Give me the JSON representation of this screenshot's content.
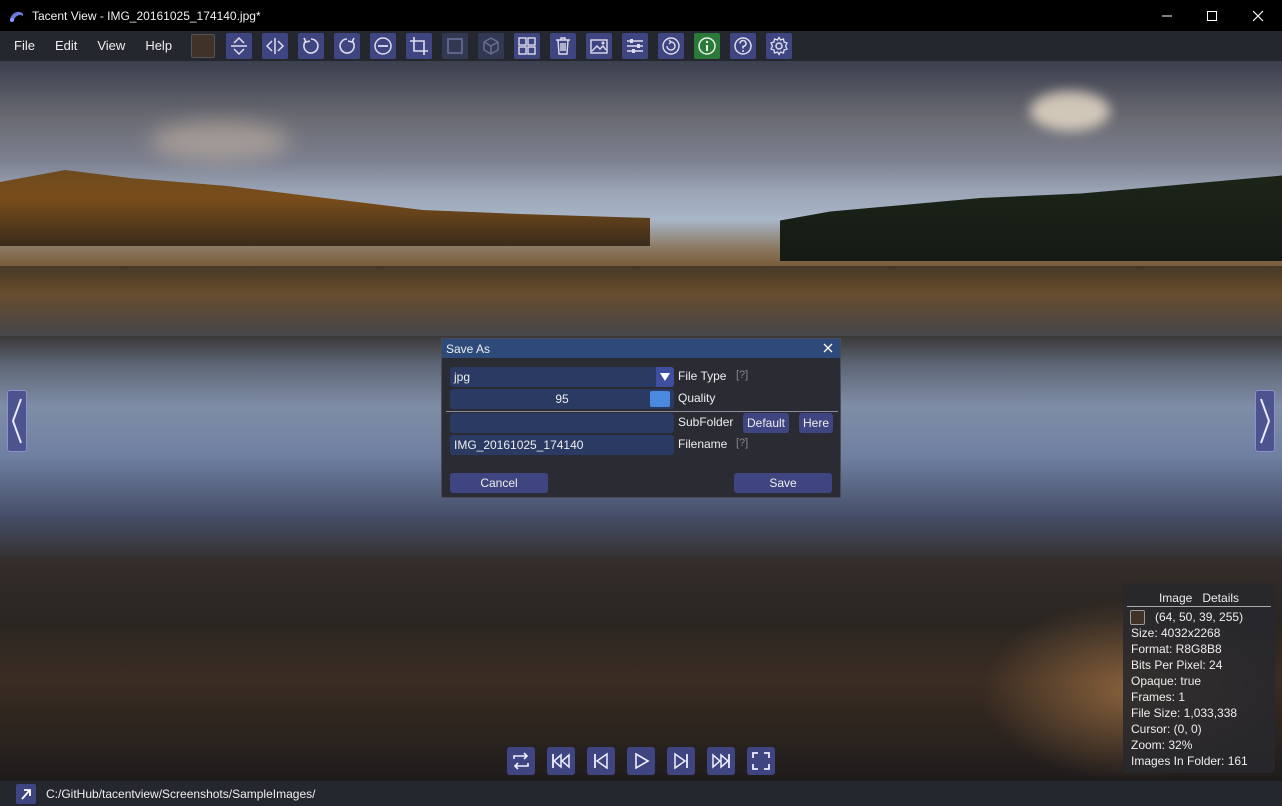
{
  "window": {
    "title": "Tacent View - IMG_20161025_174140.jpg*"
  },
  "menu": [
    "File",
    "Edit",
    "View",
    "Help"
  ],
  "toolbar": {
    "color_swatch": "#403227",
    "icons": [
      "flip-vertical",
      "flip-horizontal",
      "rotate-ccw",
      "rotate-cw",
      "zoom-out",
      "crop",
      "crop-alt",
      "cube",
      "grid",
      "trash",
      "image",
      "sliders",
      "refresh",
      "info",
      "help",
      "settings"
    ]
  },
  "dialog": {
    "title": "Save As",
    "file_type_value": "jpg",
    "file_type_label": "File Type",
    "help_marker": "[?]",
    "quality_value": "95",
    "quality_label": "Quality",
    "subfolder_value": "",
    "subfolder_label": "SubFolder",
    "default_button": "Default",
    "here_button": "Here",
    "filename_value": "IMG_20161025_174140",
    "filename_label": "Filename",
    "cancel_button": "Cancel",
    "save_button": "Save"
  },
  "details": {
    "tab_image": "Image",
    "tab_details": "Details",
    "pixel_color": "(64, 50, 39, 255)",
    "size": "Size: 4032x2268",
    "format": "Format: R8G8B8",
    "bpp": "Bits Per Pixel: 24",
    "opaque": "Opaque: true",
    "frames": "Frames: 1",
    "file_size": "File Size: 1,033,338",
    "cursor": "Cursor: (0, 0)",
    "zoom": "Zoom: 32%",
    "images_in_folder": "Images In Folder: 161"
  },
  "status": {
    "path": "C:/GitHub/tacentview/Screenshots/SampleImages/"
  },
  "colors": {
    "accent": "#3f4580",
    "title_bar": "#2d4a7a",
    "field": "#2a3a63",
    "slider": "#4a8ae0",
    "info_green": "#2c7a3a"
  }
}
